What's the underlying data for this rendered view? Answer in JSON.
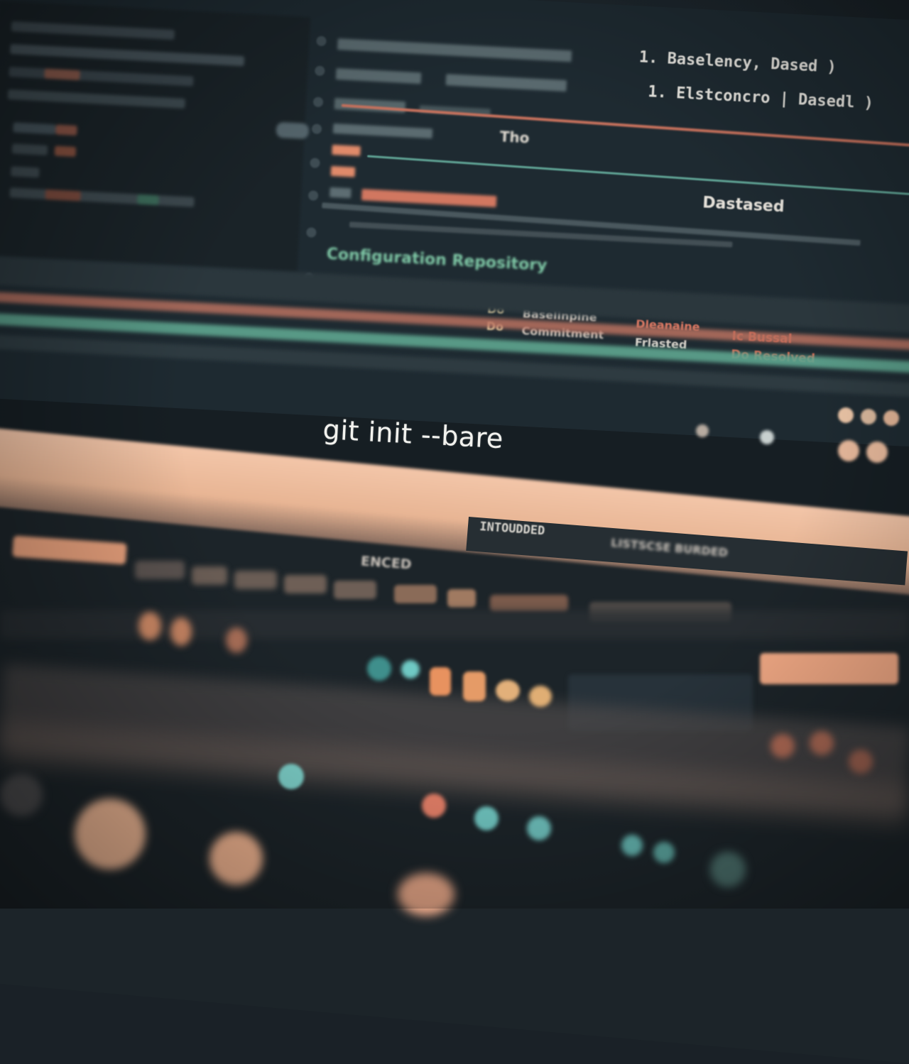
{
  "terminal": {
    "command": "git init --bare"
  },
  "editor": {
    "list_item_1_index": "1.",
    "list_item_1_text": "Baselency, Dased )",
    "list_item_2_index": "1.",
    "list_item_2_text": "Elstconcro | Dasedl )",
    "row_label_1": "Tho",
    "row_label_2": "Dastased",
    "section_heading": "Configuration Repository",
    "row_a_prefix": "Do",
    "row_b_prefix": "Do",
    "row_a_label": "Baselinpine",
    "row_b_label": "Commitment",
    "row_a_value": "Dleanaine",
    "row_b_value": "Frlasted",
    "row_a_flag": "Ic Bussal",
    "row_b_flag": "Do Resolved"
  },
  "lower_toolbar": {
    "status_text": "INTOUDDED",
    "search_label": "ENCED",
    "breadcrumb": "LISTSCSE BURDED"
  },
  "colors": {
    "accent_green": "#7fc8a6",
    "accent_red": "#e2664f",
    "accent_peach": "#f3c6a9",
    "accent_teal": "#6fc9c4"
  }
}
